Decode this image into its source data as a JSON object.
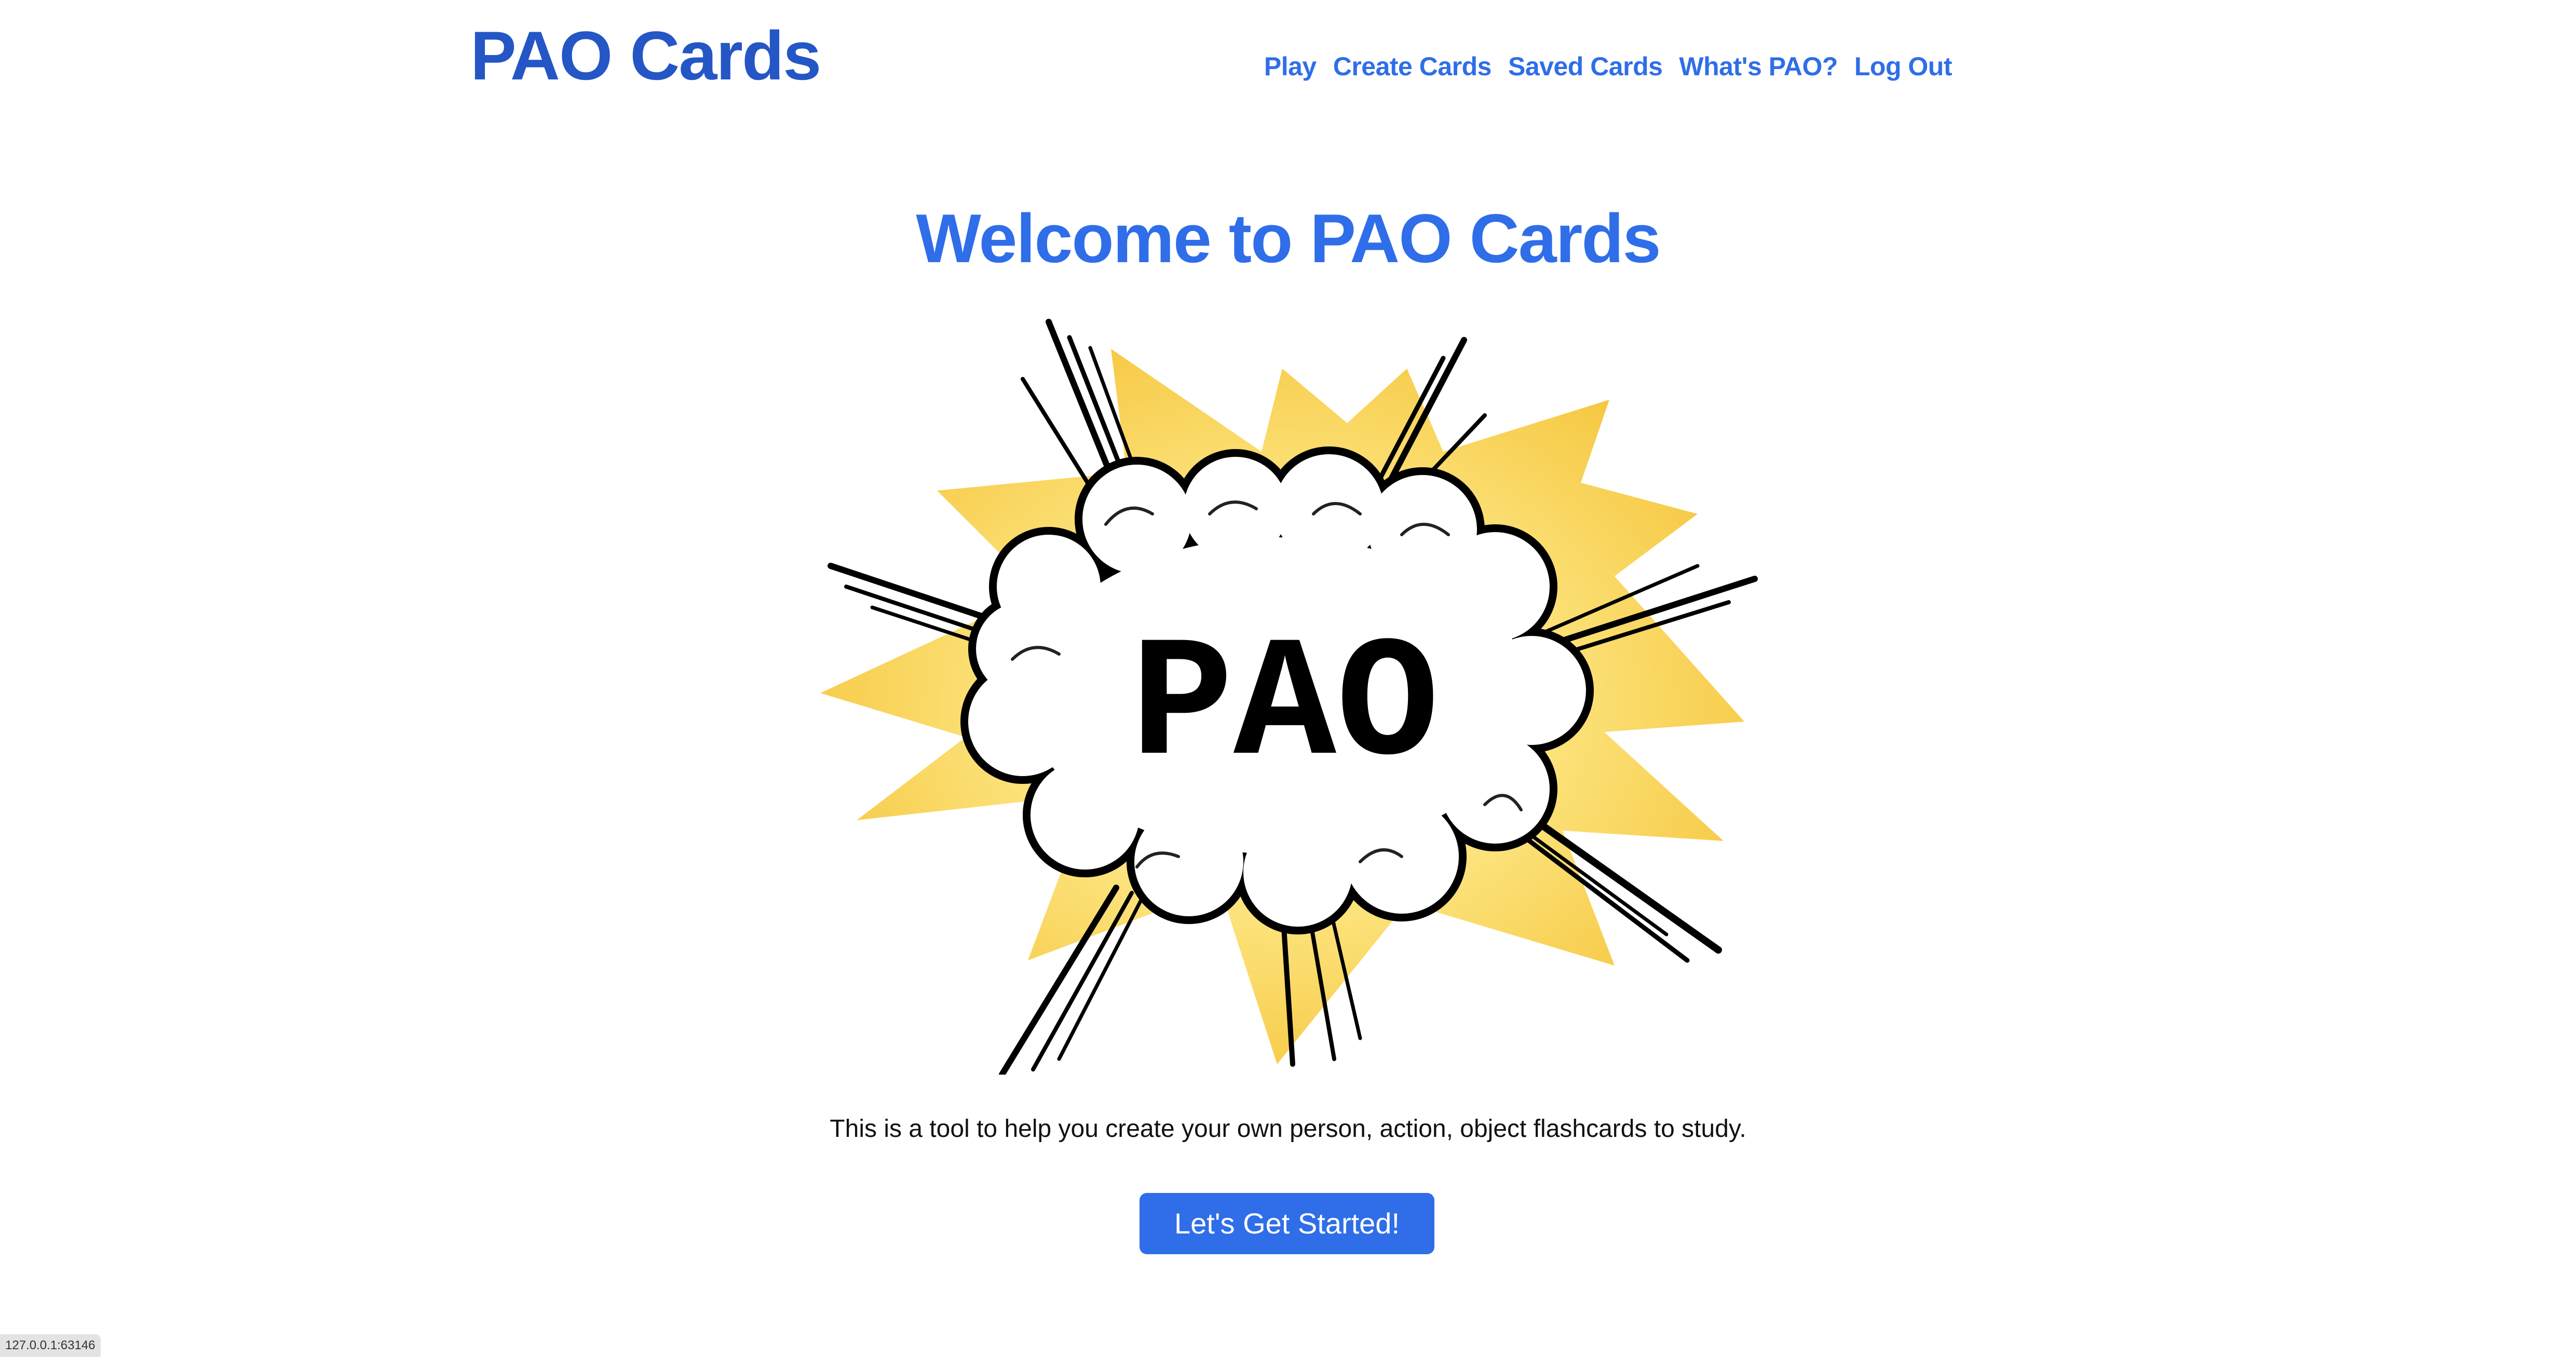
{
  "header": {
    "brand": "PAO Cards",
    "nav": [
      {
        "label": "Play"
      },
      {
        "label": "Create Cards"
      },
      {
        "label": "Saved Cards"
      },
      {
        "label": "What's PAO?"
      },
      {
        "label": "Log Out"
      }
    ]
  },
  "main": {
    "heading": "Welcome to PAO Cards",
    "hero_image": {
      "text": "PAO",
      "icon": "comic-explosion-icon"
    },
    "tagline": "This is a tool to help you create your own person, action, object flashcards to study.",
    "cta_label": "Let's Get Started!"
  },
  "status_bar": {
    "url": "127.0.0.1:63146"
  },
  "colors": {
    "brand": "#2456c5",
    "link": "#2f6ee8",
    "button": "#2f6ee8",
    "explosion_yellow": "#f8cf45",
    "explosion_light": "#fce680"
  }
}
